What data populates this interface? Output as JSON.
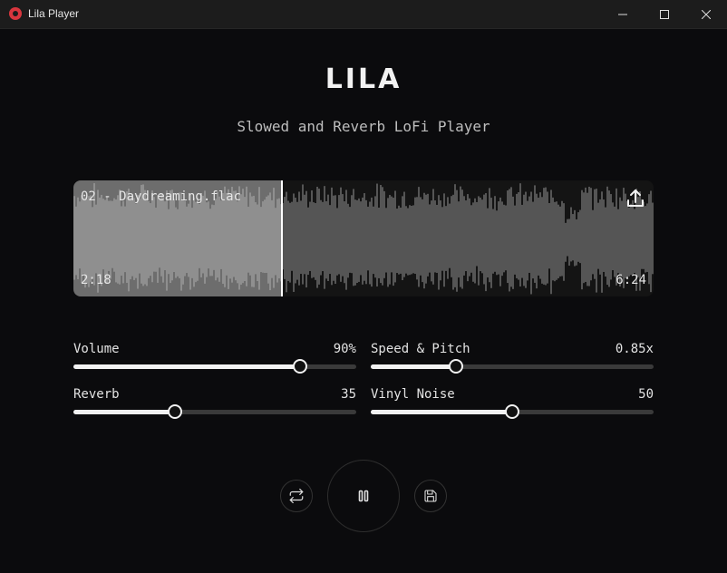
{
  "window": {
    "title": "Lila Player"
  },
  "header": {
    "logo": "LILA",
    "subtitle": "Slowed and Reverb LoFi Player"
  },
  "track": {
    "name": "02 - Daydreaming.flac",
    "current_time": "2:18",
    "total_time": "6:24",
    "progress": 0.36
  },
  "sliders": [
    {
      "label": "Volume",
      "value": "90%",
      "level": 0.8
    },
    {
      "label": "Speed & Pitch",
      "value": "0.85x",
      "level": 0.3
    },
    {
      "label": "Reverb",
      "value": "35",
      "level": 0.36
    },
    {
      "label": "Vinyl Noise",
      "value": "50",
      "level": 0.5
    }
  ],
  "controls": {
    "repeat": "repeat-icon",
    "play_pause": "pause-icon",
    "save": "save-icon"
  },
  "colors": {
    "background": "#0b0b0d",
    "waveform_played": "#8f8f8f",
    "waveform_unplayed": "#555555",
    "accent": "#f2f2f2",
    "app_icon": "#d9363e"
  }
}
